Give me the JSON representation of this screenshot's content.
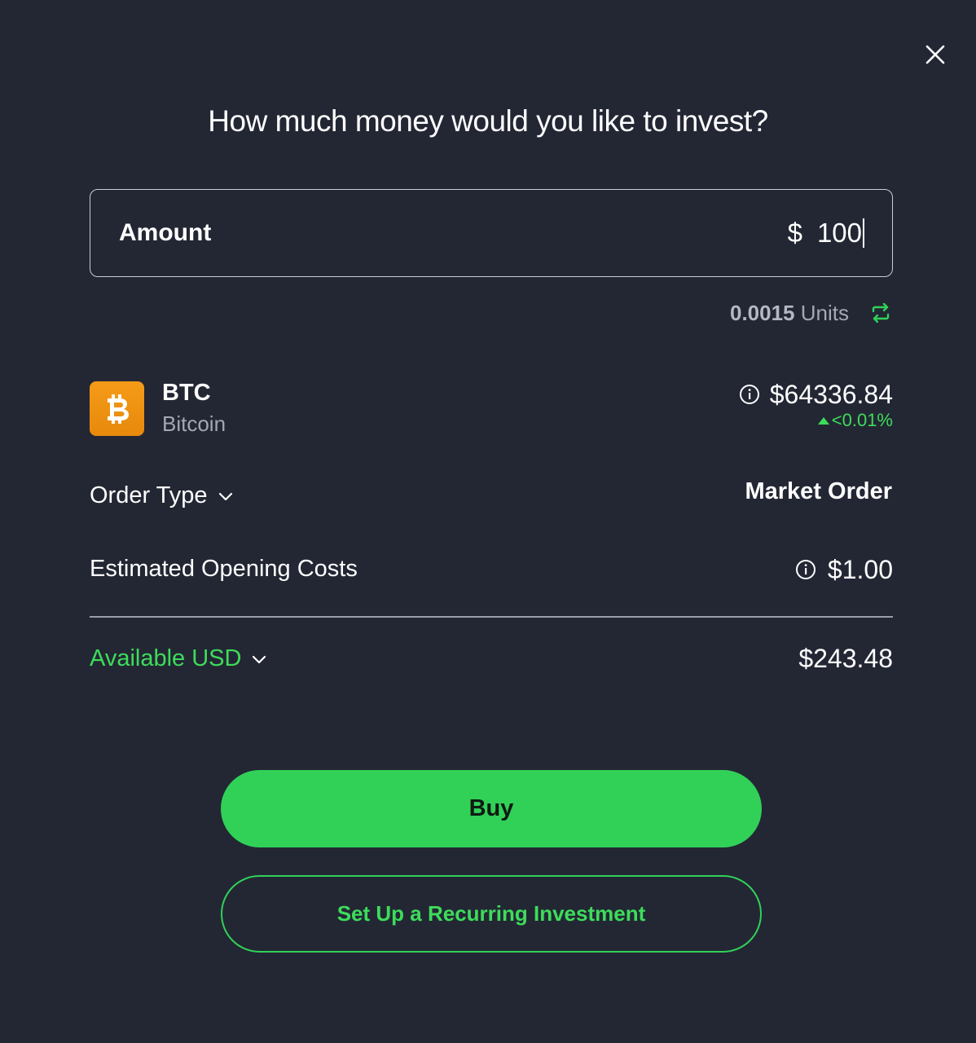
{
  "dialog": {
    "title": "How much money would you like to invest?"
  },
  "amount": {
    "label": "Amount",
    "currency_symbol": "$",
    "value": "100"
  },
  "units": {
    "value": "0.0015",
    "label": "Units"
  },
  "asset": {
    "symbol": "BTC",
    "name": "Bitcoin",
    "logo_glyph": "₿",
    "price": "$64336.84",
    "change": "<0.01%"
  },
  "order_type": {
    "label": "Order Type",
    "value": "Market Order"
  },
  "opening_costs": {
    "label": "Estimated Opening Costs",
    "value": "$1.00"
  },
  "available": {
    "label": "Available USD",
    "value": "$243.48"
  },
  "actions": {
    "buy_label": "Buy",
    "recurring_label": "Set Up a Recurring Investment"
  },
  "colors": {
    "background": "#232734",
    "accent_green": "#31d158",
    "btc_orange": "#f49b18"
  },
  "icons": {
    "close": "close-icon",
    "swap": "swap-icon",
    "info": "info-icon",
    "chevron": "chevron-down-icon",
    "trend": "triangle-up-icon"
  }
}
